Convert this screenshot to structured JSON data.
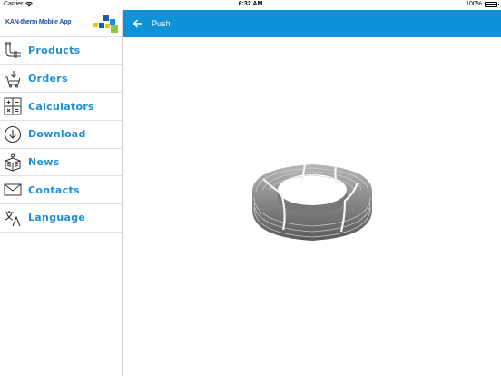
{
  "status_bar": {
    "carrier": "Carrier",
    "time": "6:32 AM",
    "battery": "100%"
  },
  "sidebar": {
    "brand": "KAN-therm Mobile App",
    "items": [
      {
        "label": "Products",
        "icon": "pipe-icon"
      },
      {
        "label": "Orders",
        "icon": "cart-icon"
      },
      {
        "label": "Calculators",
        "icon": "calculator-icon"
      },
      {
        "label": "Download",
        "icon": "download-icon"
      },
      {
        "label": "News",
        "icon": "newspaper-icon"
      },
      {
        "label": "Contacts",
        "icon": "envelope-icon"
      },
      {
        "label": "Language",
        "icon": "translate-icon"
      }
    ]
  },
  "header": {
    "title": "Push",
    "back_icon": "arrow-left-icon"
  },
  "content": {
    "image": "pipe-coil-image"
  },
  "colors": {
    "navbar": "#0f93d8",
    "menu_text": "#1e8fd6",
    "brand_text": "#1b4f9b"
  }
}
